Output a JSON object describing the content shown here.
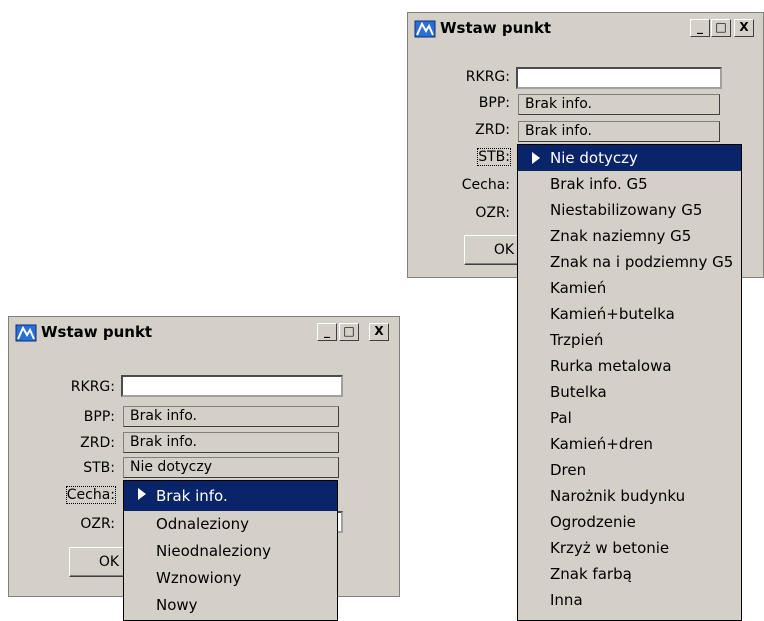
{
  "window_large": {
    "title": "Wstaw punkt",
    "labels": [
      "RKRG:",
      "BPP:",
      "ZRD:",
      "STB:",
      "Cecha:",
      "OZR:"
    ],
    "fields": {
      "bpp": "Brak info.",
      "zrd": "Brak info."
    },
    "ok_label": "OK",
    "dropdown_items": [
      "Nie dotyczy",
      "Brak info. G5",
      "Niestabilizowany G5",
      "Znak naziemny G5",
      "Znak na i podziemny G5",
      "Kamień",
      "Kamień+butelka",
      "Trzpień",
      "Rurka metalowa",
      "Butelka",
      "Pal",
      "Kamień+dren",
      "Dren",
      "Narożnik budynku",
      "Ogrodzenie",
      "Krzyż w betonie",
      "Znak farbą",
      "Inna"
    ]
  },
  "window_small": {
    "title": "Wstaw punkt",
    "labels": [
      "RKRG:",
      "BPP:",
      "ZRD:",
      "STB:",
      "Cecha:",
      "OZR:"
    ],
    "fields": {
      "bpp": "Brak info.",
      "zrd": "Brak info.",
      "stb": "Nie dotyczy"
    },
    "ok_label": "OK",
    "dropdown_items": [
      "Brak info.",
      "Odnaleziony",
      "Nieodnaleziony",
      "Wznowiony",
      "Nowy"
    ]
  },
  "caption_buttons": {
    "minimize": "_",
    "maximize": "□",
    "close": "X"
  },
  "colors": {
    "face": "#d4d0c8",
    "highlight": "#0a246a",
    "icon": "#2a6fd6"
  }
}
